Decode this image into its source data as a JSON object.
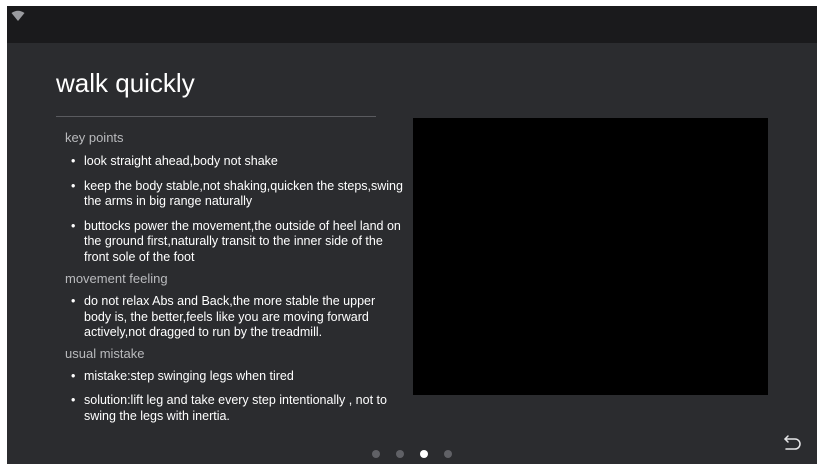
{
  "status_bar": {
    "icons": [
      "wifi-icon"
    ]
  },
  "page": {
    "title": "walk quickly"
  },
  "sections": [
    {
      "label": "key points",
      "items": [
        "look straight ahead,body not shake",
        "keep the body stable,not shaking,quicken the steps,swing the arms in big range naturally",
        "buttocks power the movement,the outside of heel land on the ground first,naturally transit to the inner side of the front sole of the foot"
      ]
    },
    {
      "label": "movement feeling",
      "items": [
        "do not relax Abs and Back,the more stable the upper body is, the better,feels like you are moving forward actively,not dragged to run by the treadmill."
      ]
    },
    {
      "label": "usual mistake",
      "items": [
        "mistake:step swinging legs when tired",
        "solution:lift leg and take every step intentionally , not to swing the legs with inertia."
      ]
    }
  ],
  "pager": {
    "count": 4,
    "active_index": 2
  },
  "colors": {
    "background": "#2b2c2f",
    "status_bar": "#1a1a1c",
    "video": "#000000",
    "section_label": "#b9babd",
    "text": "#ffffff"
  },
  "icons": {
    "back": "back-arrow-icon"
  }
}
